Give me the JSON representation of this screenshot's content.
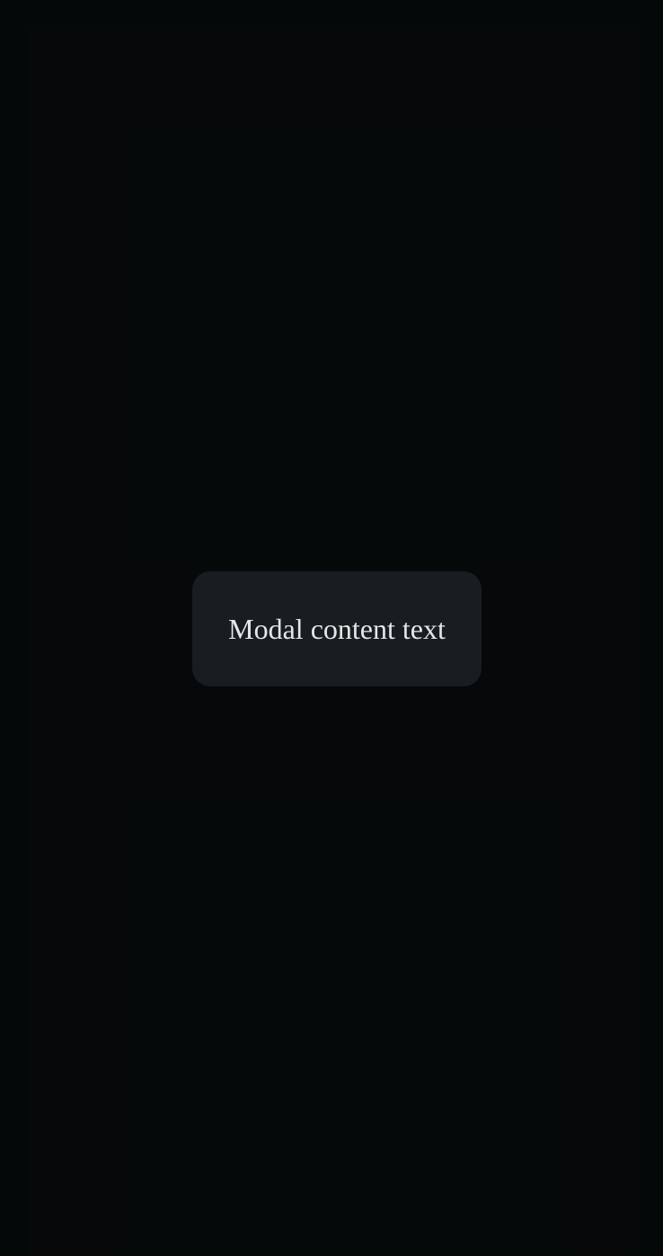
{
  "modal": {
    "content_text": "Modal content text"
  },
  "colors": {
    "page_background": "#0a0e10",
    "app_surface": "#0b0f12",
    "overlay": "rgba(0,0,0,0.42)",
    "modal_background": "#171d21",
    "modal_text": "#e6e6e6"
  }
}
